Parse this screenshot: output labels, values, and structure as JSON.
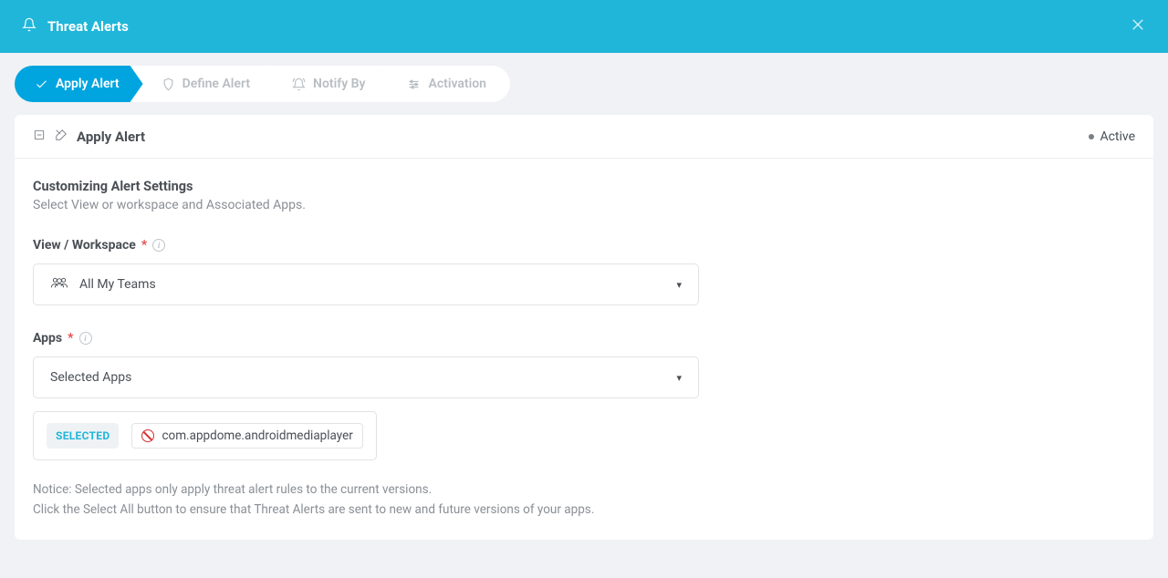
{
  "header": {
    "title": "Threat Alerts"
  },
  "steps": [
    {
      "label": "Apply Alert"
    },
    {
      "label": "Define Alert"
    },
    {
      "label": "Notify By"
    },
    {
      "label": "Activation"
    }
  ],
  "panel": {
    "title": "Apply Alert",
    "status": "Active"
  },
  "section": {
    "title": "Customizing Alert Settings",
    "subtitle": "Select View or workspace and Associated Apps."
  },
  "form": {
    "viewWorkspace": {
      "label": "View / Workspace",
      "value": "All My Teams"
    },
    "apps": {
      "label": "Apps",
      "value": "Selected Apps"
    }
  },
  "chips": {
    "selectedLabel": "SELECTED",
    "items": [
      "com.appdome.androidmediaplayer"
    ]
  },
  "notice": {
    "line1": "Notice: Selected apps only apply threat alert rules to the current versions.",
    "line2": "Click the Select All button to ensure that Threat Alerts are sent to new and future versions of your apps."
  }
}
